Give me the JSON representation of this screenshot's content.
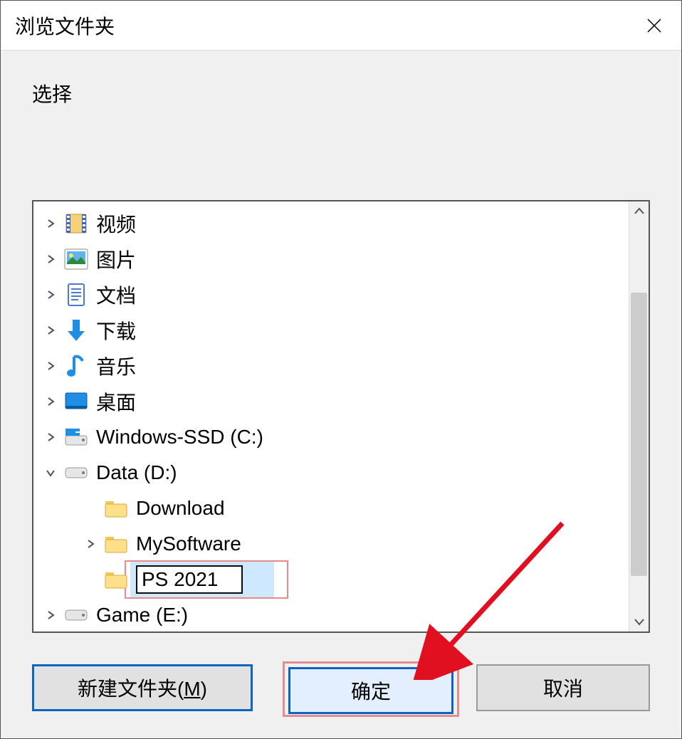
{
  "window": {
    "title": "浏览文件夹",
    "instruction": "选择"
  },
  "tree": [
    {
      "id": "videos",
      "depth": 0,
      "expander": "collapsed",
      "icon": "video",
      "label": "视频"
    },
    {
      "id": "pictures",
      "depth": 0,
      "expander": "collapsed",
      "icon": "picture",
      "label": "图片"
    },
    {
      "id": "documents",
      "depth": 0,
      "expander": "collapsed",
      "icon": "doc",
      "label": "文档"
    },
    {
      "id": "downloads",
      "depth": 0,
      "expander": "collapsed",
      "icon": "download",
      "label": "下载"
    },
    {
      "id": "music",
      "depth": 0,
      "expander": "collapsed",
      "icon": "music",
      "label": "音乐"
    },
    {
      "id": "desktop",
      "depth": 0,
      "expander": "collapsed",
      "icon": "desktop",
      "label": "桌面"
    },
    {
      "id": "drive-c",
      "depth": 0,
      "expander": "collapsed",
      "icon": "drive-c",
      "label": "Windows-SSD (C:)"
    },
    {
      "id": "drive-d",
      "depth": 0,
      "expander": "expanded",
      "icon": "drive",
      "label": "Data (D:)"
    },
    {
      "id": "d-download",
      "depth": 1,
      "expander": "none",
      "icon": "folder",
      "label": "Download"
    },
    {
      "id": "d-mysoft",
      "depth": 1,
      "expander": "collapsed",
      "icon": "folder",
      "label": "MySoftware"
    },
    {
      "id": "d-ps2021",
      "depth": 1,
      "expander": "none",
      "icon": "folder",
      "label": "PS 2021",
      "editing": true,
      "selected": true
    },
    {
      "id": "drive-e",
      "depth": 0,
      "expander": "collapsed",
      "icon": "drive",
      "label": "Game (E:)"
    }
  ],
  "buttons": {
    "new_folder_label": "新建文件夹(",
    "new_folder_mnemonic": "M",
    "new_folder_suffix": ")",
    "ok_label": "确定",
    "cancel_label": "取消"
  },
  "annotations": {
    "selected_folder_highlight": true,
    "ok_button_highlight": true,
    "arrow_pointing_to_ok": true
  }
}
